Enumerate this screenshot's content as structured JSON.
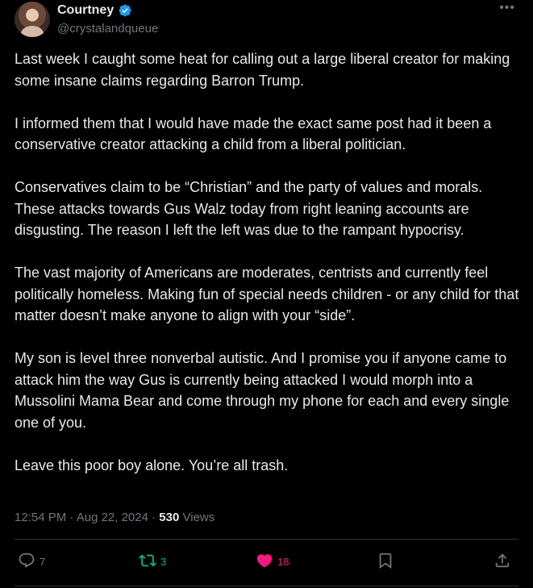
{
  "author": {
    "name": "Courtney",
    "handle": "@crystalandqueue",
    "verified": true,
    "verified_color": "#1d9bf0"
  },
  "more_icon": "more-horizontal-icon",
  "post": {
    "paragraphs": [
      "Last week I caught some heat for calling out a large liberal creator for making some insane claims regarding Barron Trump.",
      "I informed them that I would have made the exact same post had it been a conservative creator attacking a child from a liberal politician.",
      "Conservatives claim to be “Christian” and the party of values and morals. These attacks towards Gus Walz today from right leaning accounts are disgusting. The reason I left the left was due to the rampant hypocrisy.",
      "The vast majority of Americans are moderates, centrists and currently feel politically homeless. Making fun of special needs children - or any child for that matter doesn’t make anyone to align with your “side”.",
      "My son is level three nonverbal autistic. And I promise you if anyone came to attack him the way Gus is currently being attacked I would morph into a Mussolini Mama Bear and come through my phone for each and every single one of you.",
      "Leave this poor boy alone. You’re all trash."
    ],
    "timestamp": "12:54 PM · Aug 22, 2024",
    "separator": " · ",
    "views_count": "530",
    "views_label": "Views"
  },
  "actions": {
    "reply": {
      "icon": "reply-icon",
      "count": "7",
      "color": "#71767b"
    },
    "repost": {
      "icon": "repost-icon",
      "count": "3",
      "color": "#00ba7c"
    },
    "like": {
      "icon": "heart-icon",
      "count": "18",
      "color": "#f91880"
    },
    "bookmark": {
      "icon": "bookmark-icon",
      "color": "#71767b"
    },
    "share": {
      "icon": "share-icon",
      "color": "#71767b"
    }
  }
}
